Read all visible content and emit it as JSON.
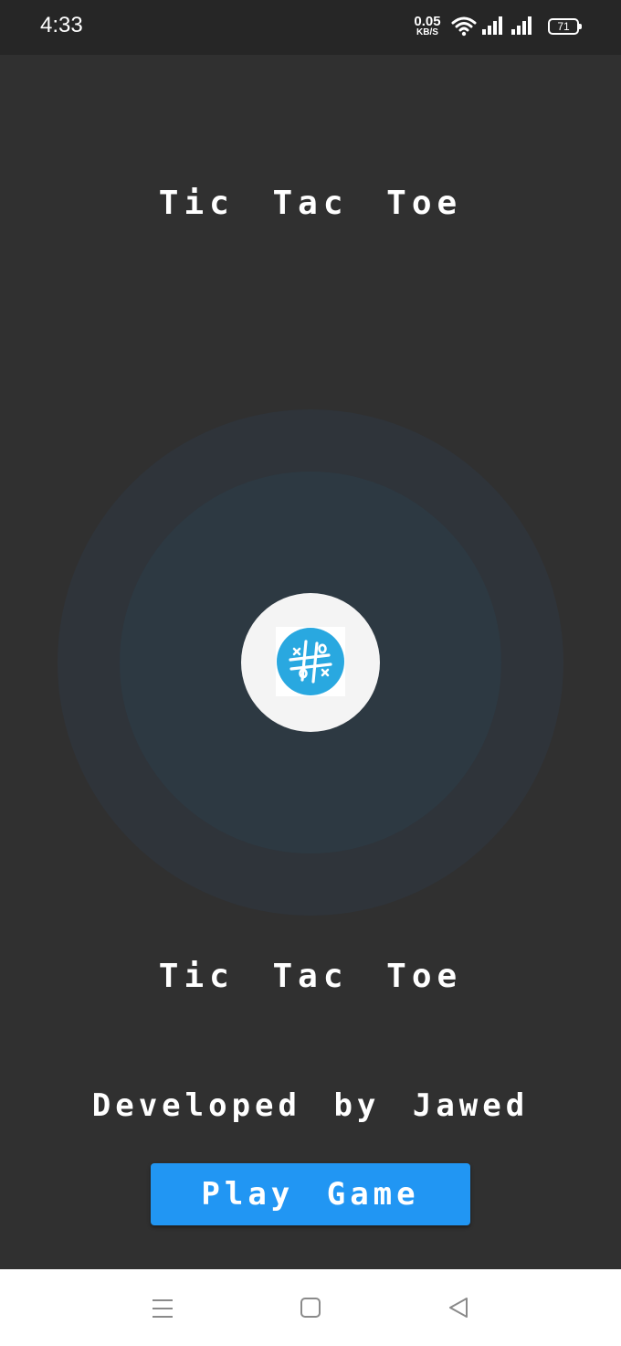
{
  "status_bar": {
    "time": "4:33",
    "net_speed_value": "0.05",
    "net_speed_unit": "KB/S",
    "battery": "71",
    "icons": [
      "wifi-icon",
      "signal-icon",
      "signal-icon",
      "battery-icon"
    ]
  },
  "app": {
    "title_top": "Tic Tac Toe",
    "logo_icon": "tic-tac-toe-logo-icon",
    "title_bottom": "Tic Tac Toe",
    "developer": "Developed by Jawed",
    "play_button": "Play Game"
  },
  "nav_bar": {
    "icons": [
      "menu-icon",
      "home-square-icon",
      "back-triangle-icon"
    ]
  },
  "colors": {
    "background": "#303030",
    "status_bar": "#262626",
    "button": "#2196f3",
    "logo_blue": "#29a8e0",
    "ring_outer": "#2f343a",
    "ring_inner": "#2d3942"
  }
}
